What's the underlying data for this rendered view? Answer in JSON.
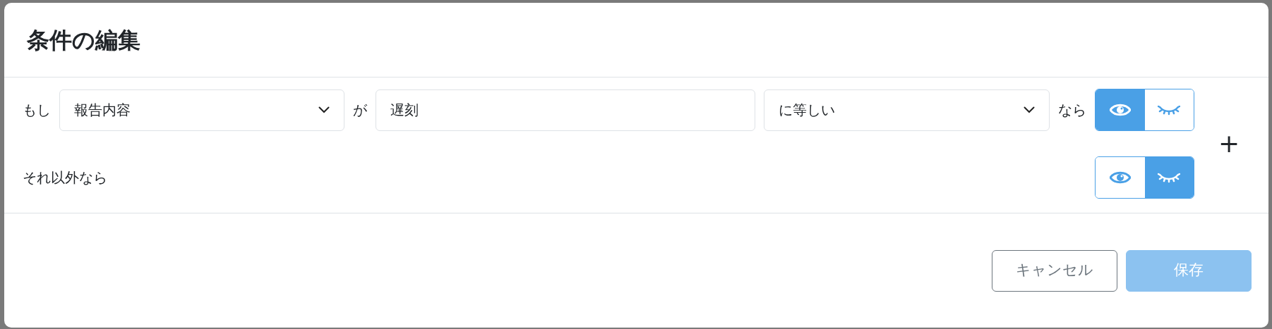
{
  "dialog": {
    "title": "条件の編集"
  },
  "condition": {
    "prefix": "もし",
    "field": {
      "value": "報告内容"
    },
    "connector": "が",
    "value_field": {
      "value": "遅刻"
    },
    "operator": {
      "value": "に等しい"
    },
    "suffix": "なら",
    "visibility": [
      {
        "kind": "show",
        "selected": true
      },
      {
        "kind": "hide",
        "selected": false
      }
    ]
  },
  "otherwise": {
    "label": "それ以外なら",
    "visibility": [
      {
        "kind": "show",
        "selected": false
      },
      {
        "kind": "hide",
        "selected": true
      }
    ]
  },
  "add_button": {
    "label": "+"
  },
  "buttons": [
    {
      "kind": "cancel",
      "label": "キャンセル",
      "disabled": false
    },
    {
      "kind": "save",
      "label": "保存",
      "disabled": true
    }
  ]
}
